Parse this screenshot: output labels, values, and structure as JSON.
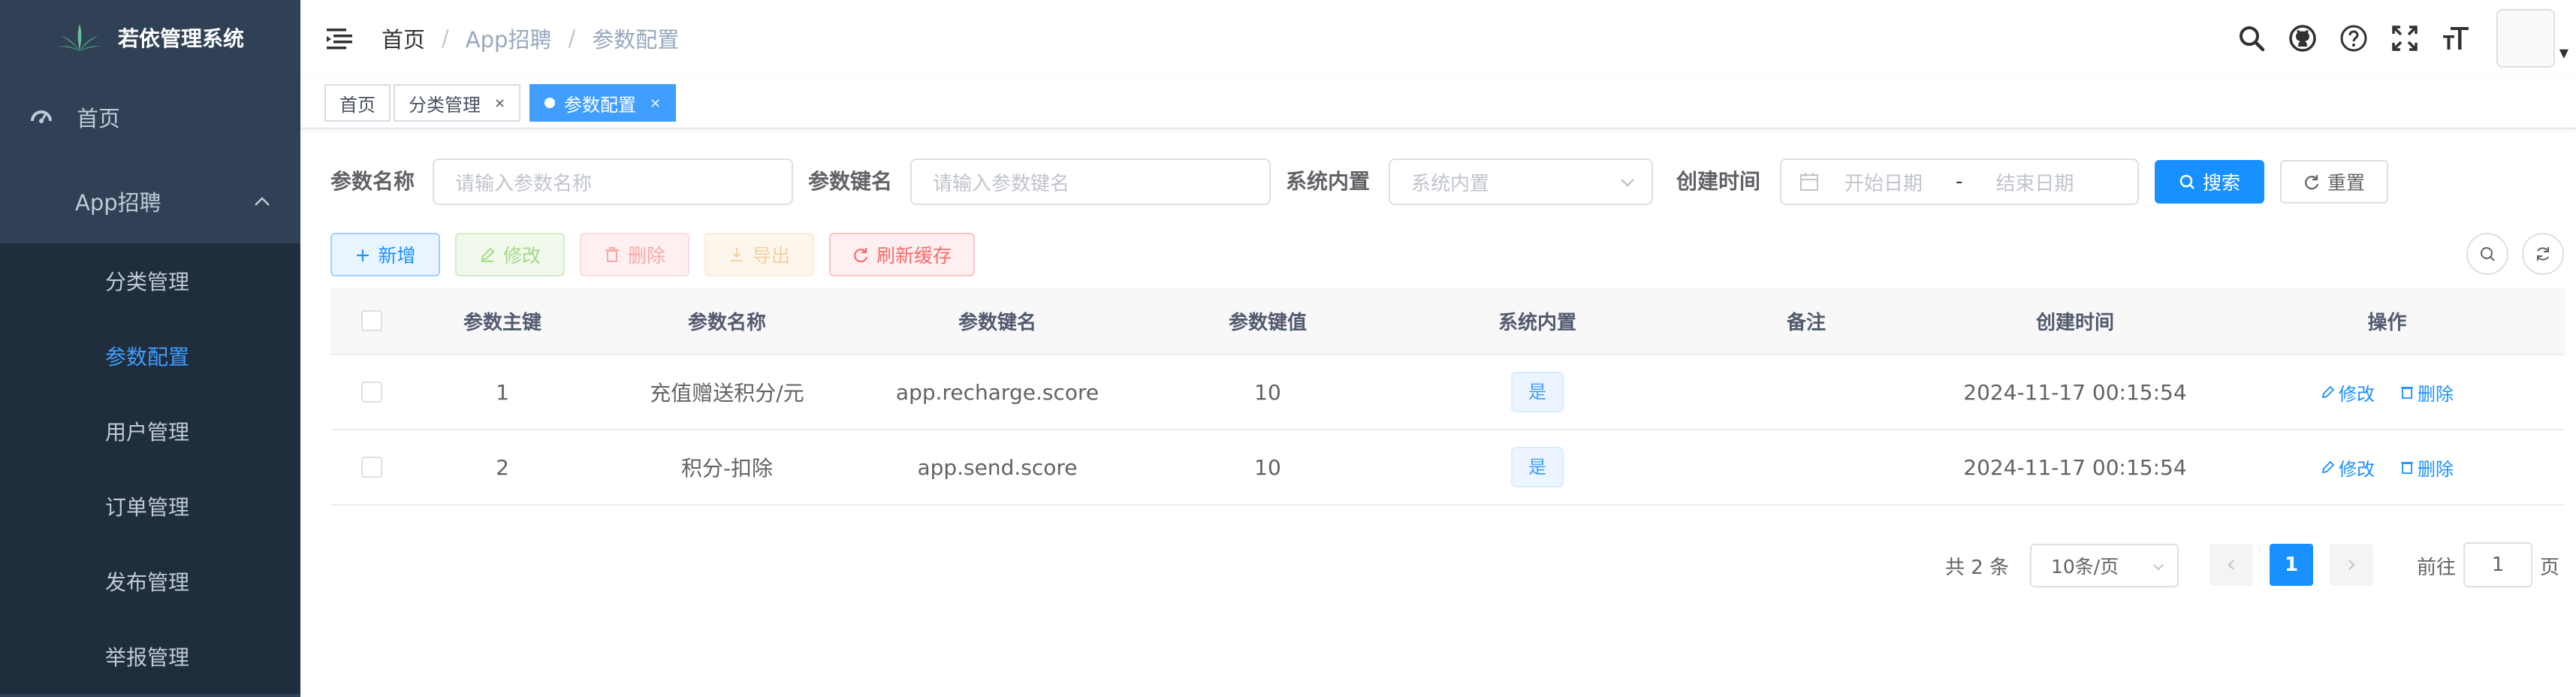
{
  "app": {
    "title": "若依管理系统"
  },
  "sidebar": {
    "home": "首页",
    "group": "App招聘",
    "items": [
      {
        "label": "分类管理",
        "active": false
      },
      {
        "label": "参数配置",
        "active": true
      },
      {
        "label": "用户管理",
        "active": false
      },
      {
        "label": "订单管理",
        "active": false
      },
      {
        "label": "发布管理",
        "active": false
      },
      {
        "label": "举报管理",
        "active": false
      }
    ]
  },
  "breadcrumb": {
    "home": "首页",
    "level1": "App招聘",
    "level2": "参数配置",
    "separator": "/"
  },
  "tags": {
    "home": "首页",
    "category": "分类管理",
    "active": "参数配置",
    "close": "×"
  },
  "search": {
    "name_label": "参数名称",
    "name_placeholder": "请输入参数名称",
    "key_label": "参数键名",
    "key_placeholder": "请输入参数键名",
    "builtin_label": "系统内置",
    "builtin_placeholder": "系统内置",
    "time_label": "创建时间",
    "start_placeholder": "开始日期",
    "end_placeholder": "结束日期",
    "range_sep": "-",
    "search_btn": "搜索",
    "reset_btn": "重置"
  },
  "toolbar": {
    "add": "新增",
    "edit": "修改",
    "delete": "删除",
    "export": "导出",
    "refresh_cache": "刷新缓存"
  },
  "table": {
    "headers": [
      "参数主键",
      "参数名称",
      "参数键名",
      "参数键值",
      "系统内置",
      "备注",
      "创建时间",
      "操作"
    ],
    "rows": [
      {
        "id": "1",
        "name": "充值赠送积分/元",
        "key": "app.recharge.score",
        "value": "10",
        "builtin": "是",
        "remark": "",
        "created": "2024-11-17 00:15:54"
      },
      {
        "id": "2",
        "name": "积分-扣除",
        "key": "app.send.score",
        "value": "10",
        "builtin": "是",
        "remark": "",
        "created": "2024-11-17 00:15:54"
      }
    ],
    "op_edit": "修改",
    "op_delete": "删除"
  },
  "pagination": {
    "total": "共 2 条",
    "page_size": "10条/页",
    "current": "1",
    "goto_prefix": "前往",
    "goto_value": "1",
    "goto_suffix": "页"
  },
  "colors": {
    "sidebar_bg": "#304156",
    "submenu_bg": "#1f2d3d",
    "primary": "#1890ff",
    "active_menu": "#409eff"
  }
}
